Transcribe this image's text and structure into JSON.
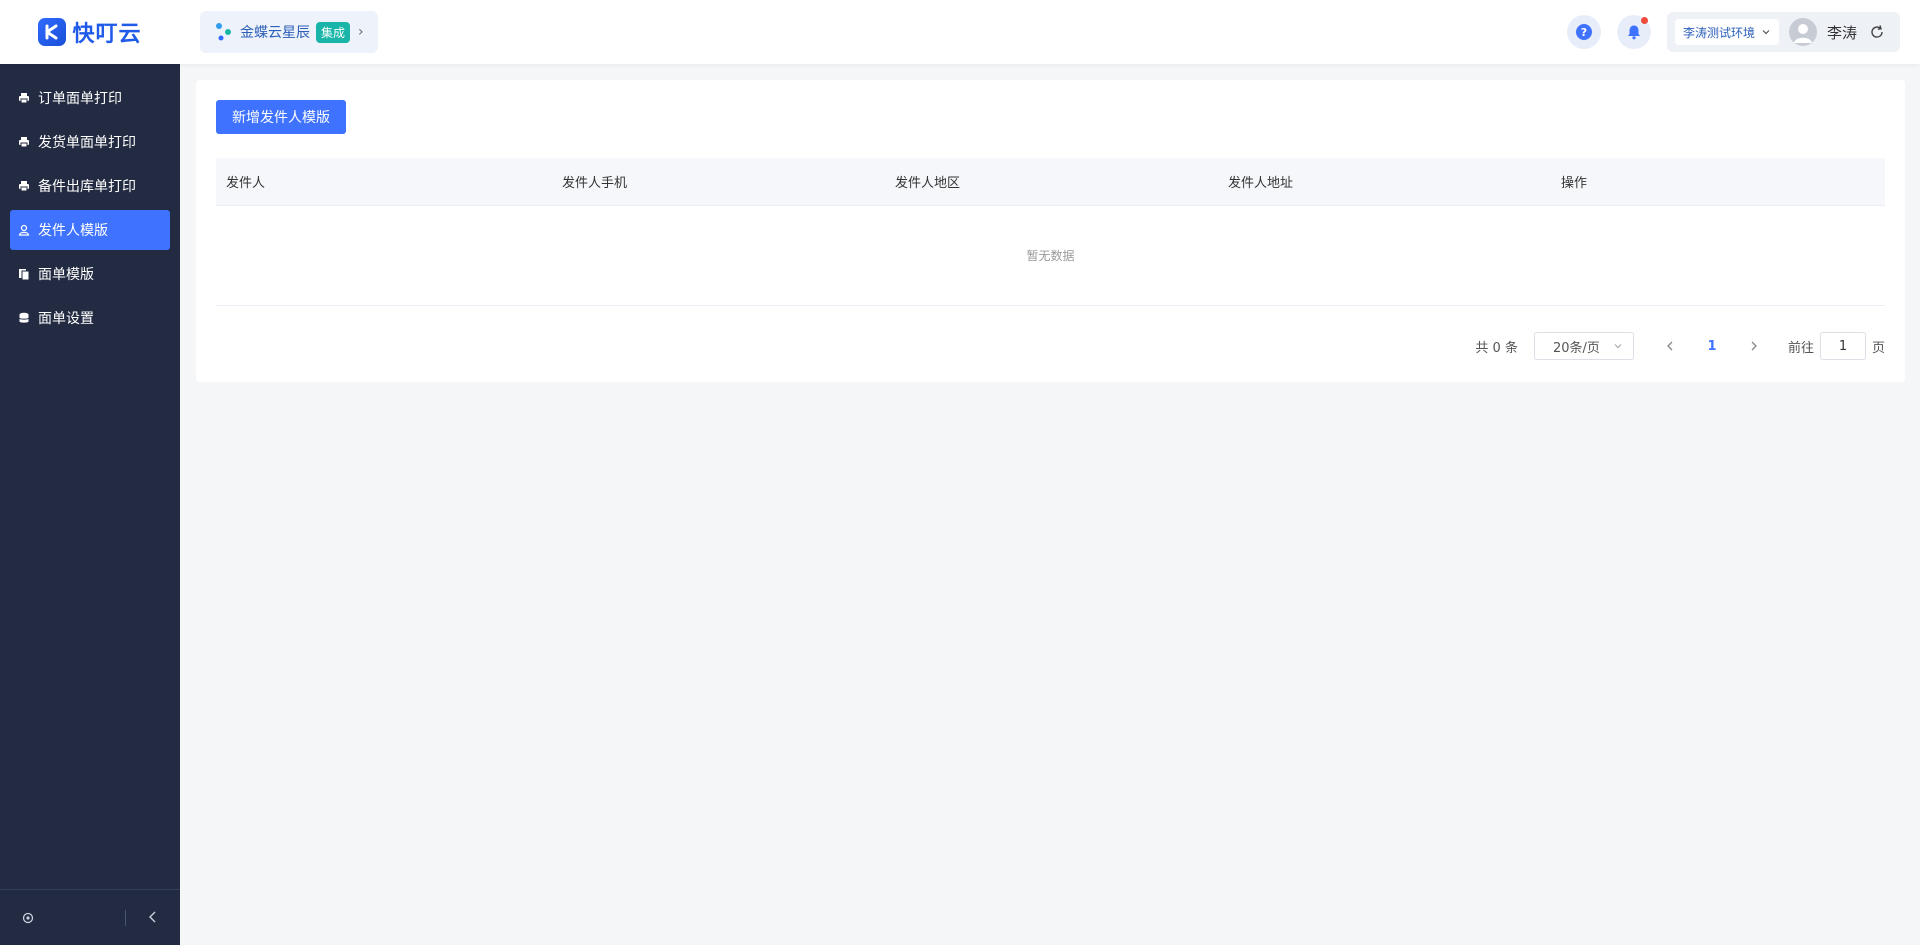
{
  "app": {
    "name": "快叮云"
  },
  "integration": {
    "name": "金蝶云星辰",
    "tag": "集成"
  },
  "header": {
    "env": "李涛测试环境",
    "user": "李涛"
  },
  "sidebar": {
    "items": [
      {
        "label": "订单面单打印",
        "icon": "printer-icon"
      },
      {
        "label": "发货单面单打印",
        "icon": "printer-icon"
      },
      {
        "label": "备件出库单打印",
        "icon": "printer-icon"
      },
      {
        "label": "发件人模版",
        "icon": "user-icon",
        "active": true
      },
      {
        "label": "面单模版",
        "icon": "document-icon"
      },
      {
        "label": "面单设置",
        "icon": "database-icon"
      }
    ]
  },
  "main": {
    "add_button": "新增发件人模版",
    "table": {
      "columns": [
        "发件人",
        "发件人手机",
        "发件人地区",
        "发件人地址",
        "操作"
      ],
      "empty_text": "暂无数据"
    },
    "pagination": {
      "total": "共 0 条",
      "page_size": "20条/页",
      "current_page": "1",
      "goto_label": "前往",
      "goto_value": "1",
      "goto_suffix": "页"
    }
  },
  "colors": {
    "primary": "#3f73ff",
    "sidebar_bg": "#222b42",
    "tag": "#18b5a8",
    "badge": "#f04a3a"
  }
}
